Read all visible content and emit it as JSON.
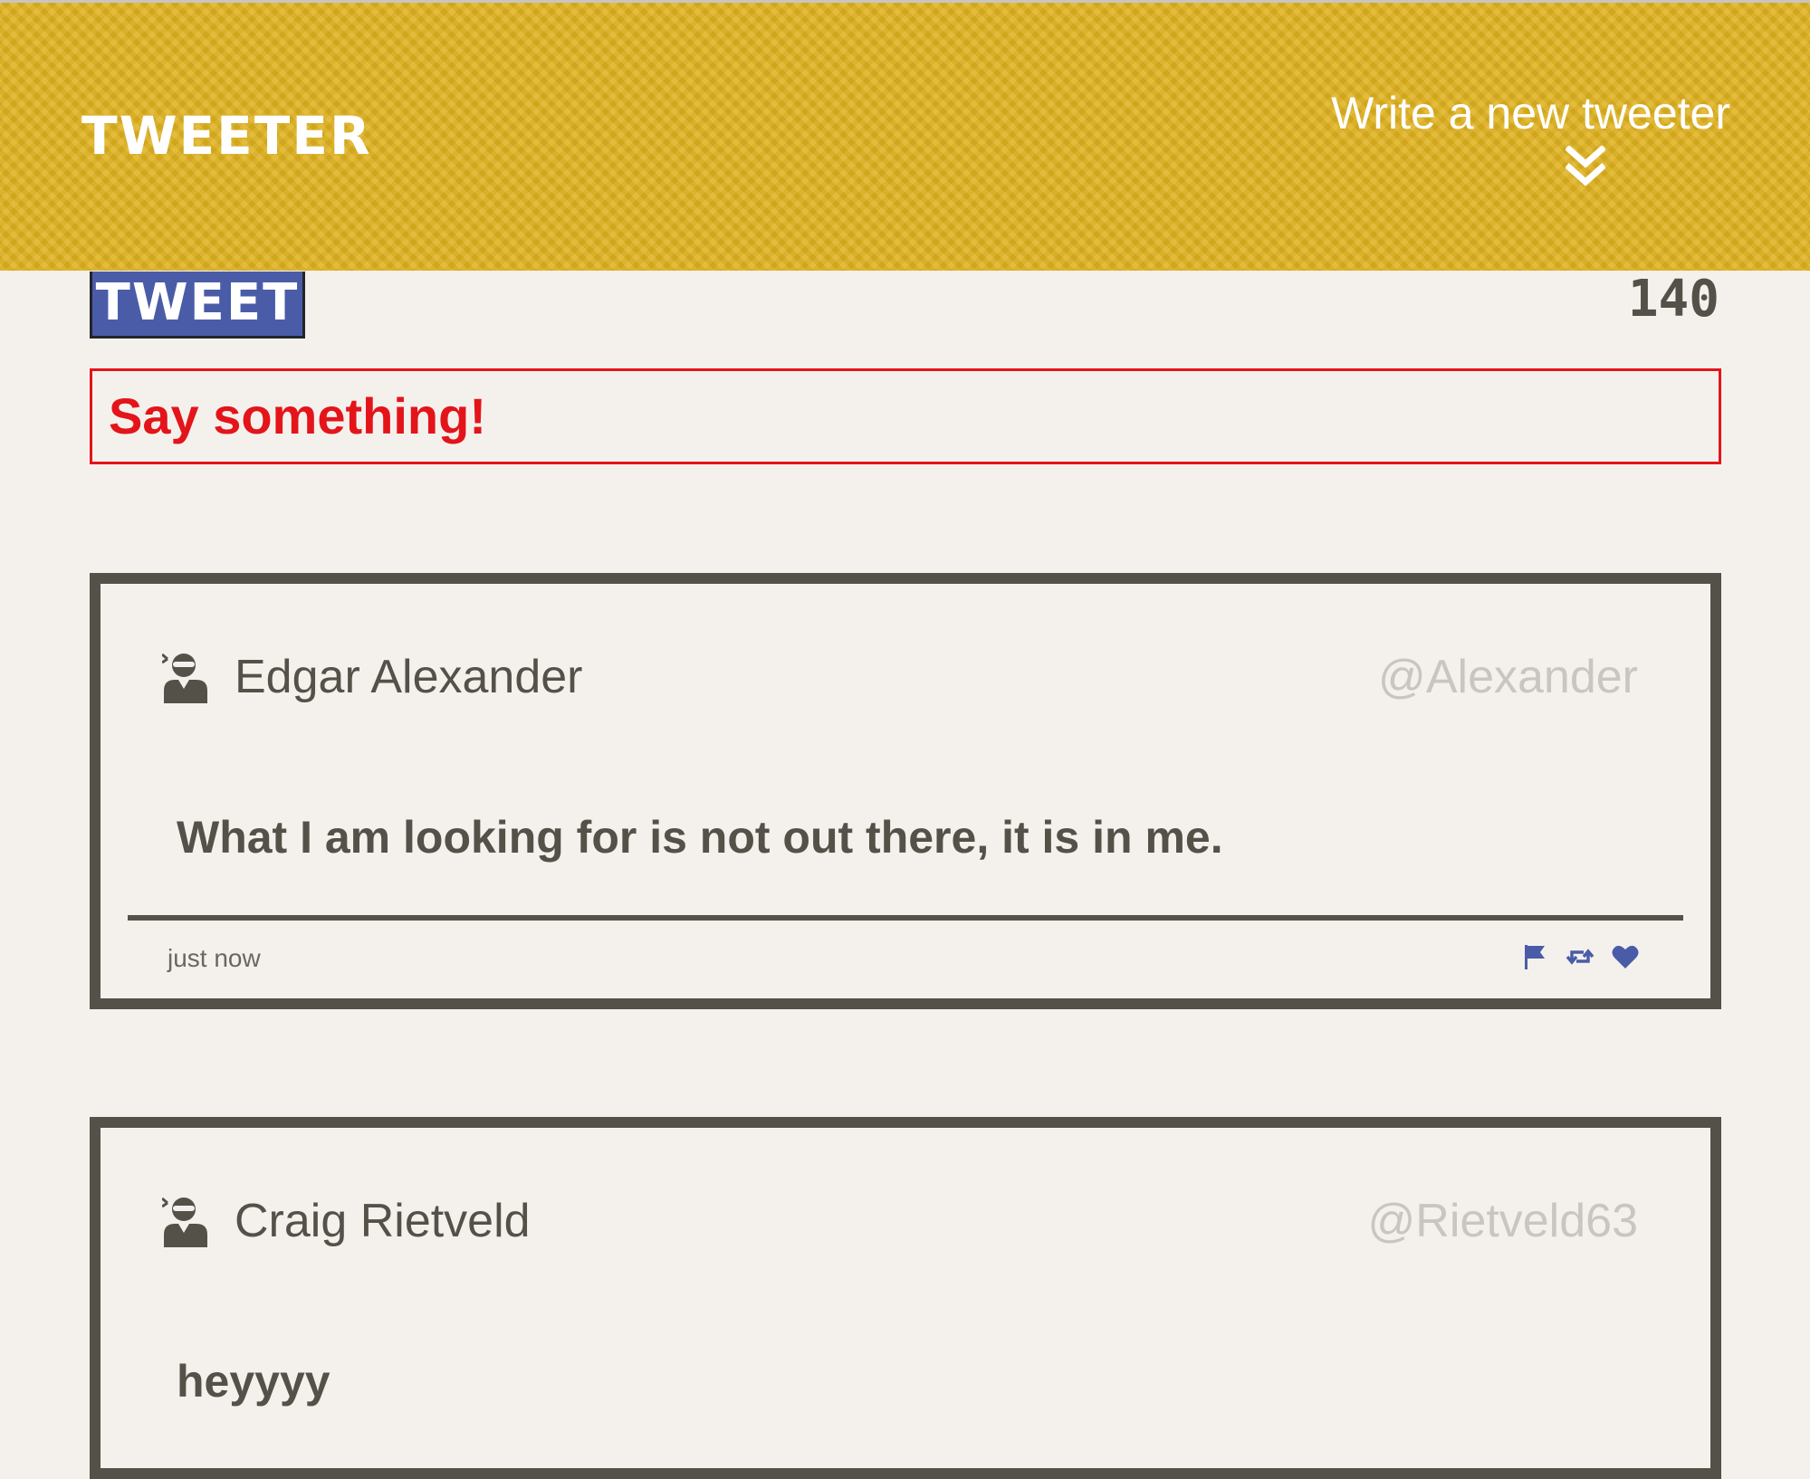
{
  "nav": {
    "brand": "TWEETER",
    "compose_label": "Write a new tweeter",
    "compose_icon": "double-chevron-down-icon"
  },
  "composer": {
    "button_label": "TWEET",
    "counter": "140",
    "error_message": "Say something!",
    "error_color": "#e3151a",
    "button_color": "#4a5ca8"
  },
  "colors": {
    "header": "#e0b21f",
    "background": "#f4f1ed",
    "text": "#545149",
    "accent_icons": "#4a5ca8"
  },
  "tweets": [
    {
      "name": "Edgar Alexander",
      "handle": "@Alexander",
      "avatar_icon": "user-ninja-icon",
      "text": "What I am looking for is not out there, it is in me.",
      "timestamp": "just now",
      "actions": [
        "flag-icon",
        "retweet-icon",
        "heart-icon"
      ]
    },
    {
      "name": "Craig Rietveld",
      "handle": "@Rietveld63",
      "avatar_icon": "user-ninja-icon",
      "text": "heyyyy"
    }
  ]
}
